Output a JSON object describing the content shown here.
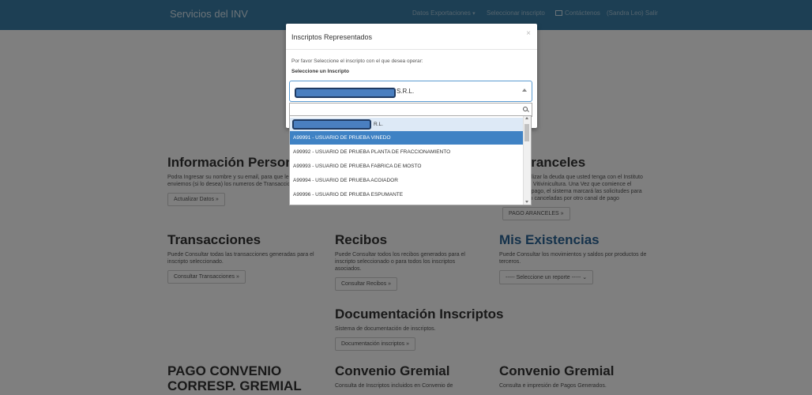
{
  "navbar": {
    "brand": "Servicios del INV",
    "items": [
      "Datos Exportaciones",
      "Seleccionar inscripto",
      "Contáctenos",
      "(Sandra Leo) Salir"
    ]
  },
  "sections": [
    {
      "title": "Información Personal",
      "text": "Podra Ingresar su nombre y su email, para que le enviemos (si lo desea) los numeros de Transacciones",
      "button": "Actualizar Datos »"
    },
    {
      "title": "de Aranceles",
      "text": "Podrá visualizar la deuda que usted tenga con el Instituto Nacional de Vitivinicultura. Una Vez que comience el proceso de pago, el sistema marcará las solicitudes para que no sean canceladas por otro canal de pago",
      "button": "PAGO ARANCELES »"
    },
    {
      "title": "Transacciones",
      "text": "Puede Consultar todas las transacciones generadas para el inscripto seleccionado.",
      "button": "Consultar Transacciones »"
    },
    {
      "title": "Recibos",
      "text": "Puede Consultar todos los recibos generados para el inscripto seleccionado o para todos los inscriptos asociados.",
      "button": "Consultar Recibos »"
    },
    {
      "title": "Mis Existencias",
      "text": "Puede Consultar los movimientos y saldos por productos de terceros.",
      "select": "----- Seleccione un reporte -----"
    },
    {
      "title": "Documentación Inscriptos",
      "text": "Sistema de documentación de inscriptos.",
      "button": "Documentación inscriptos »"
    },
    {
      "title": "PAGO CONVENIO CORRESP. GREMIAL",
      "text": ""
    },
    {
      "title": "Convenio Gremial",
      "text": "Consulta de Inscriptos incluidos en Convenio de"
    },
    {
      "title": "Convenio Gremial",
      "text": "Consulta e impresión de Pagos Generados."
    }
  ],
  "modal": {
    "title": "Inscriptos Representados",
    "close": "×",
    "prompt": "Por favor Seleccione el inscripto con el que desea operar:",
    "label": "Seleccione un Inscripto",
    "selected_suffix": "S.R.L.",
    "options": [
      "R.L.",
      "A99991 - USUARIO DE PRUEBA VINEDO",
      "A99992 - USUARIO DE PRUEBA PLANTA DE FRACCIONAMIENTO",
      "A99993 - USUARIO DE PRUEBA FABRICA DE MOSTO",
      "A99994 - USUARIO DE PRUEBA ACOIADOR",
      "A99996 - USUARIO DE PRUEBA ESPUMANTE"
    ]
  }
}
